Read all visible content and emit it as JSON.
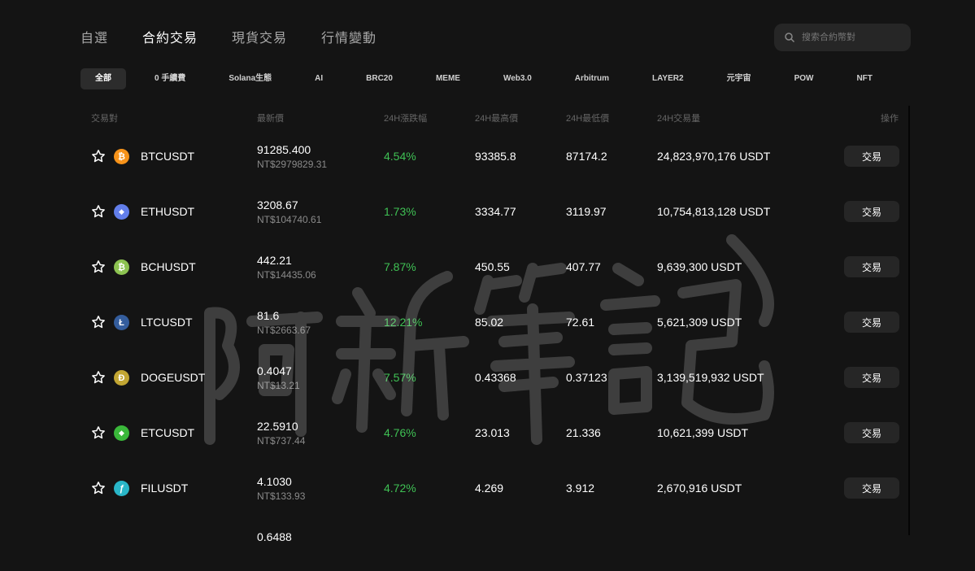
{
  "topnav": {
    "tabs": [
      {
        "label": "自選"
      },
      {
        "label": "合約交易"
      },
      {
        "label": "現貨交易"
      },
      {
        "label": "行情變動"
      }
    ]
  },
  "search": {
    "placeholder": "搜索合約幣對"
  },
  "filters": [
    {
      "label": "全部"
    },
    {
      "label": "0 手續費"
    },
    {
      "label": "Solana生態"
    },
    {
      "label": "AI"
    },
    {
      "label": "BRC20"
    },
    {
      "label": "MEME"
    },
    {
      "label": "Web3.0"
    },
    {
      "label": "Arbitrum"
    },
    {
      "label": "LAYER2"
    },
    {
      "label": "元宇宙"
    },
    {
      "label": "POW"
    },
    {
      "label": "NFT"
    }
  ],
  "table": {
    "headers": {
      "pair": "交易對",
      "price": "最新價",
      "change": "24H漲跌幅",
      "high": "24H最高價",
      "low": "24H最低價",
      "volume": "24H交易量",
      "action": "操作"
    },
    "trade_label": "交易",
    "rows": [
      {
        "symbol": "BTCUSDT",
        "price": "91285.400",
        "twd": "NT$2979829.31",
        "change": "4.54%",
        "high": "93385.8",
        "low": "87174.2",
        "volume": "24,823,970,176 USDT",
        "icon_color": "#f7931a",
        "icon": "bitcoin-icon",
        "glyph": "₿"
      },
      {
        "symbol": "ETHUSDT",
        "price": "3208.67",
        "twd": "NT$104740.61",
        "change": "1.73%",
        "high": "3334.77",
        "low": "3119.97",
        "volume": "10,754,813,128 USDT",
        "icon_color": "#627eea",
        "icon": "ethereum-icon",
        "glyph": "◆"
      },
      {
        "symbol": "BCHUSDT",
        "price": "442.21",
        "twd": "NT$14435.06",
        "change": "7.87%",
        "high": "450.55",
        "low": "407.77",
        "volume": "9,639,300 USDT",
        "icon_color": "#8dc351",
        "icon": "bitcoin-cash-icon",
        "glyph": "₿"
      },
      {
        "symbol": "LTCUSDT",
        "price": "81.6",
        "twd": "NT$2663.67",
        "change": "12.21%",
        "high": "85.02",
        "low": "72.61",
        "volume": "5,621,309 USDT",
        "icon_color": "#345d9d",
        "icon": "litecoin-icon",
        "glyph": "Ł"
      },
      {
        "symbol": "DOGEUSDT",
        "price": "0.4047",
        "twd": "NT$13.21",
        "change": "7.57%",
        "high": "0.43368",
        "low": "0.37123",
        "volume": "3,139,519,932 USDT",
        "icon_color": "#c2a633",
        "icon": "dogecoin-icon",
        "glyph": "Ð"
      },
      {
        "symbol": "ETCUSDT",
        "price": "22.5910",
        "twd": "NT$737.44",
        "change": "4.76%",
        "high": "23.013",
        "low": "21.336",
        "volume": "10,621,399 USDT",
        "icon_color": "#3ab83a",
        "icon": "ethereum-classic-icon",
        "glyph": "◆"
      },
      {
        "symbol": "FILUSDT",
        "price": "4.1030",
        "twd": "NT$133.93",
        "change": "4.72%",
        "high": "4.269",
        "low": "3.912",
        "volume": "2,670,916 USDT",
        "icon_color": "#0090ff",
        "icon": "filecoin-icon",
        "glyph": "ƒ"
      },
      {
        "symbol": "",
        "price": "0.6488",
        "twd": "",
        "change": "",
        "high": "",
        "low": "",
        "volume": "",
        "icon_color": "#141414",
        "icon": "",
        "glyph": ""
      }
    ]
  },
  "watermark": "阿新筆記"
}
